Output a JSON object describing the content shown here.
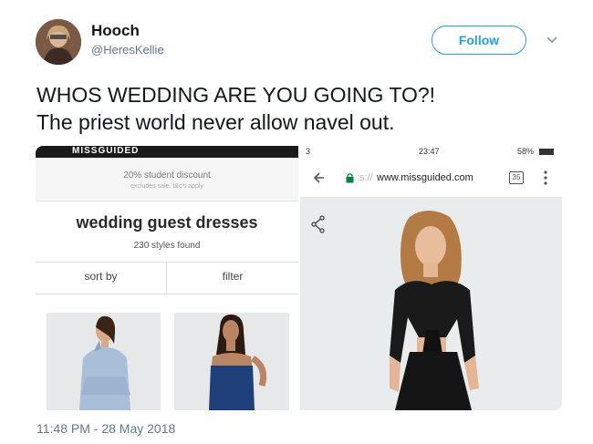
{
  "tweet": {
    "display_name": "Hooch",
    "handle": "@HeresKellie",
    "follow_label": "Follow",
    "text_line1": "WHOS WEDDING ARE YOU GOING TO?!",
    "text_line2": "The priest world never allow navel out.",
    "timestamp": "11:48 PM - 28 May 2018"
  },
  "left_screenshot": {
    "brand": "MISSGUIDED",
    "discount": "20% student discount",
    "discount_sub": "excludes sale. t&c's apply",
    "heading": "wedding guest dresses",
    "styles_found": "230 styles found",
    "sort_label": "sort by",
    "filter_label": "filter"
  },
  "right_screenshot": {
    "status_left": "3",
    "status_time": "23:47",
    "status_battery": "58%",
    "url": "www.missguided.com",
    "tab_count": "35"
  },
  "colors": {
    "accent": "#1da1f2",
    "muted": "#657786"
  }
}
